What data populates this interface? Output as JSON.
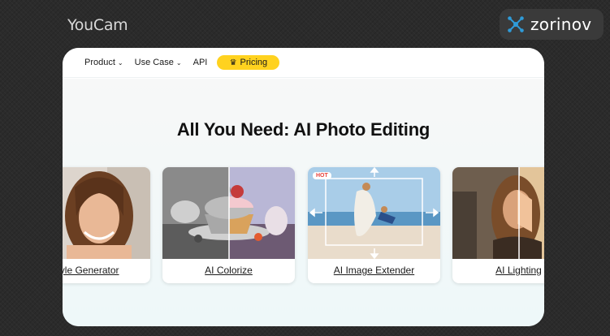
{
  "background": {
    "logo_text": "YouCam"
  },
  "brand_badge": {
    "name": "zorinov",
    "accent": "#2f9bd8"
  },
  "navbar": {
    "items": [
      {
        "label": "Product",
        "has_dropdown": true
      },
      {
        "label": "Use Case",
        "has_dropdown": true
      },
      {
        "label": "API",
        "has_dropdown": false
      }
    ],
    "chevron_icon": "chevron-down-icon",
    "pricing": {
      "label": "Pricing",
      "icon": "crown-icon",
      "color": "#ffd21f"
    }
  },
  "hero": {
    "title": "All You Need: AI Photo Editing",
    "cards": [
      {
        "label": "rstyle Generator"
      },
      {
        "label": "AI Colorize"
      },
      {
        "label": "AI Image Extender",
        "badge": "HOT"
      },
      {
        "label": "AI Lighting"
      }
    ]
  }
}
